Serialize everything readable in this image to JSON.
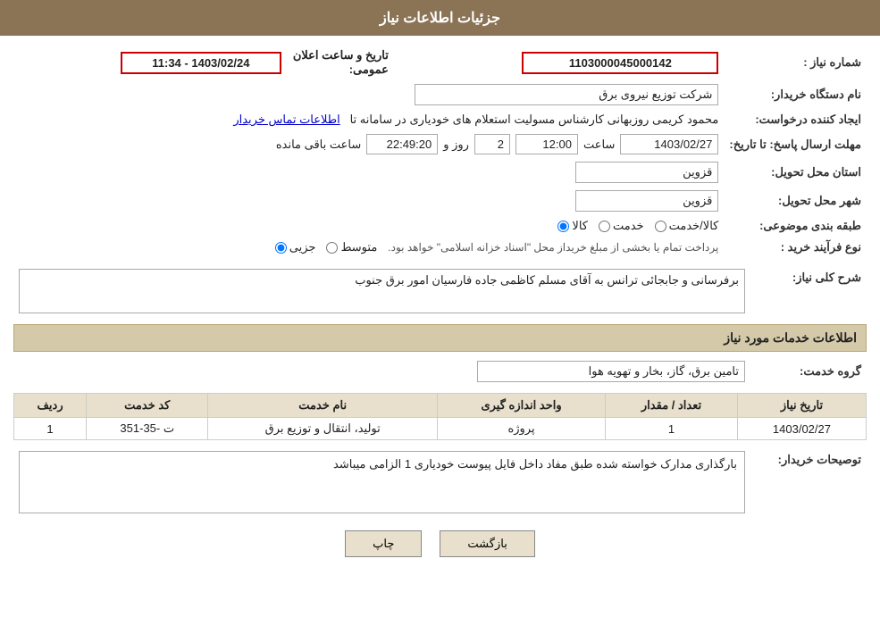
{
  "header": {
    "title": "جزئیات اطلاعات نیاز"
  },
  "fields": {
    "shmare_niaz_label": "شماره نیاز :",
    "shmare_niaz_value": "1103000045000142",
    "nam_dastgah_label": "نام دستگاه خریدار:",
    "nam_dastgah_value": "شرکت توزیع نیروی برق",
    "ejad_konande_label": "ایجاد کننده درخواست:",
    "ejad_konande_value": "محمود کریمی روزبهانی کارشناس  مسولیت استعلام های خودیاری در سامانه تا",
    "ejad_konande_link": "اطلاعات تماس خریدار",
    "mohlet_label": "مهلت ارسال پاسخ: تا تاریخ:",
    "mohlet_date": "1403/02/27",
    "mohlet_saet": "12:00",
    "mohlet_roz": "2",
    "mohlet_mande": "22:49:20",
    "mohlet_saet_label": "ساعت",
    "mohlet_roz_label": "روز و",
    "mohlet_mande_label": "ساعت باقی مانده",
    "ostan_label": "استان محل تحویل:",
    "ostan_value": "قزوین",
    "shahr_label": "شهر محل تحویل:",
    "shahr_value": "قزوین",
    "tabaqe_label": "طبقه بندی موضوعی:",
    "tabaqe_kala": "کالا",
    "tabaqe_khedmat": "خدمت",
    "tabaqe_kala_khedmat": "کالا/خدمت",
    "tabaqe_selected": "کالا",
    "now_label": "نوع فرآیند خرید :",
    "now_jazii": "جزیی",
    "now_mottaset": "متوسط",
    "now_tozih": "پرداخت تمام یا بخشی از مبلغ خریداز محل \"اسناد خزانه اسلامی\" خواهد بود.",
    "sharh_section": "شرح کلی نیاز:",
    "sharh_value": "برفرسانی و جابجائی ترانس به آقای مسلم کاظمی جاده فارسیان امور برق جنوب",
    "khadamat_section": "اطلاعات خدمات مورد نیاز",
    "group_label": "گروه خدمت:",
    "group_value": "تامین برق، گاز، بخار و تهویه هوا",
    "table_headers": {
      "radif": "ردیف",
      "code": "کد خدمت",
      "name": "نام خدمت",
      "vahed": "واحد اندازه گیری",
      "tedad": "تعداد / مقدار",
      "tarikh": "تاریخ نیاز"
    },
    "table_rows": [
      {
        "radif": "1",
        "code": "ت -35-351",
        "name": "تولید، انتقال و توزیع برق",
        "vahed": "پروژه",
        "tedad": "1",
        "tarikh": "1403/02/27"
      }
    ],
    "tosih_label": "توصیحات خریدار:",
    "tosih_value": "بارگذاری مدارک خواسته شده طبق مفاد داخل فایل پیوست خودیاری 1 الزامی میباشد",
    "btn_chap": "چاپ",
    "btn_bazgasht": "بازگشت"
  }
}
